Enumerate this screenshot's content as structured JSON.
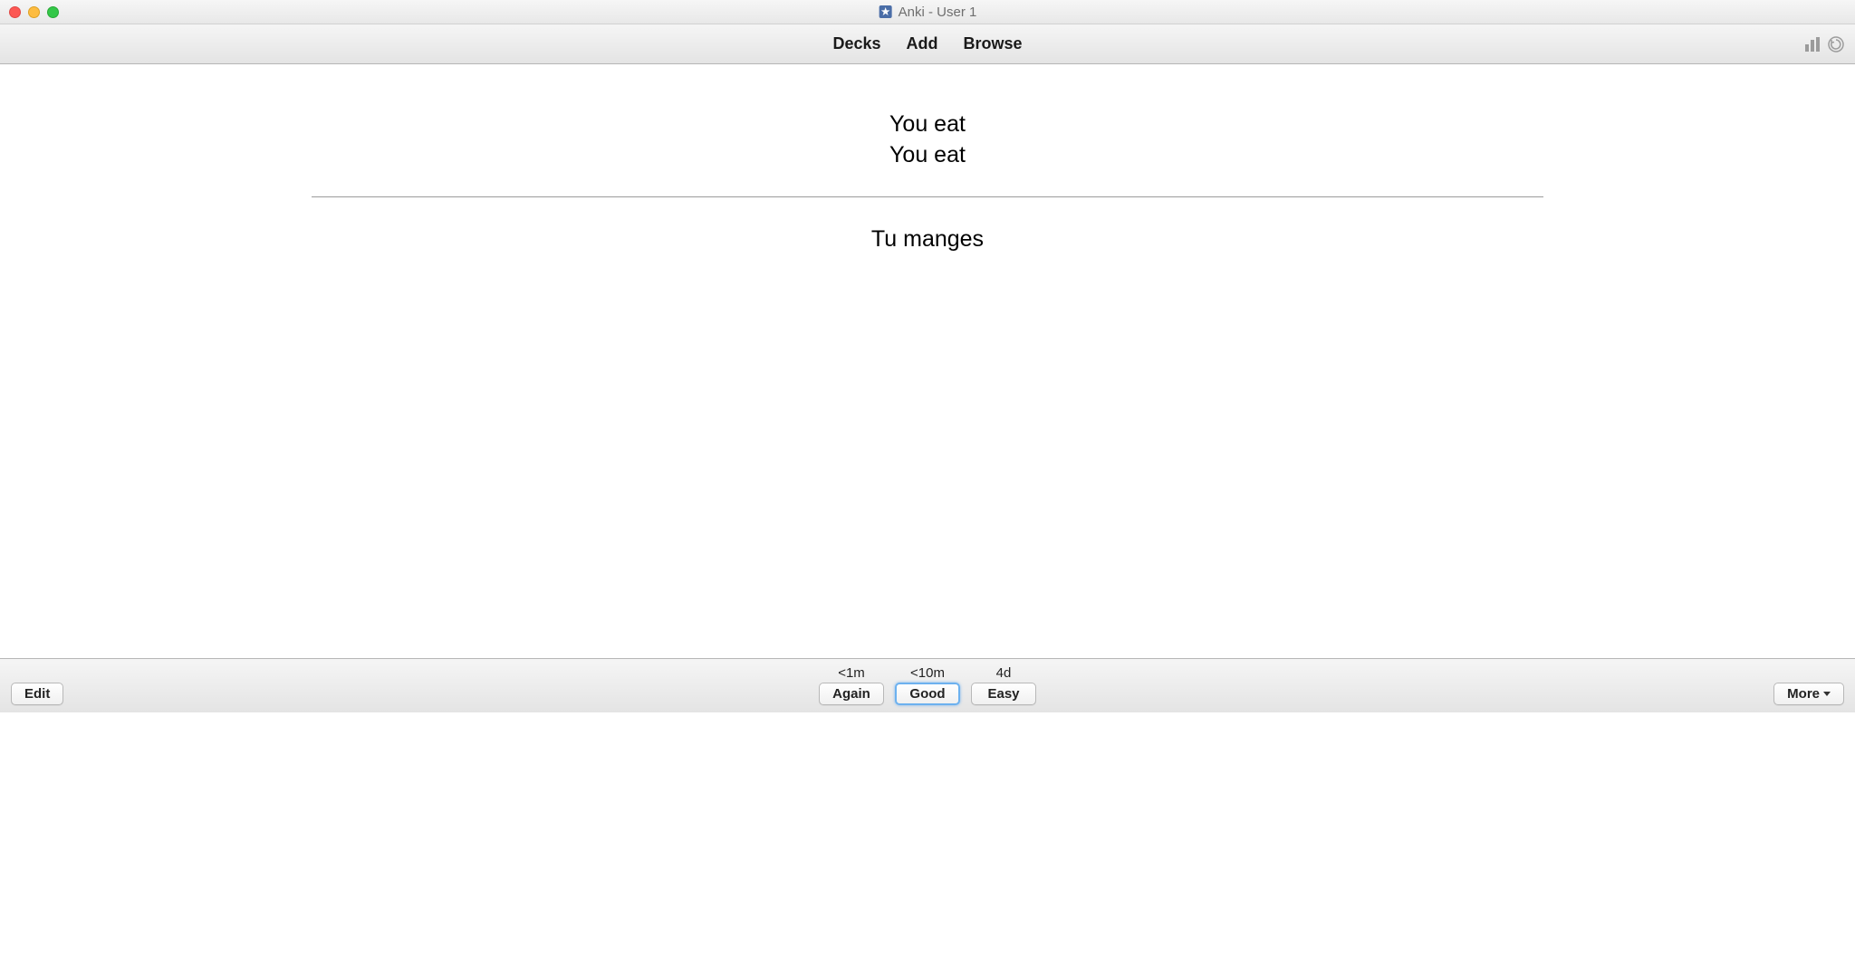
{
  "window": {
    "title": "Anki - User 1"
  },
  "toolbar": {
    "decks": "Decks",
    "add": "Add",
    "browse": "Browse"
  },
  "card": {
    "front_line1": "You eat",
    "front_line2": "You eat",
    "back": "Tu manges"
  },
  "bottombar": {
    "edit": "Edit",
    "more": "More",
    "answers": [
      {
        "interval": "<1m",
        "label": "Again"
      },
      {
        "interval": "<10m",
        "label": "Good"
      },
      {
        "interval": "4d",
        "label": "Easy"
      }
    ]
  },
  "icons": {
    "app": "anki-star-icon",
    "stats": "bar-chart-icon",
    "sync": "sync-icon"
  }
}
